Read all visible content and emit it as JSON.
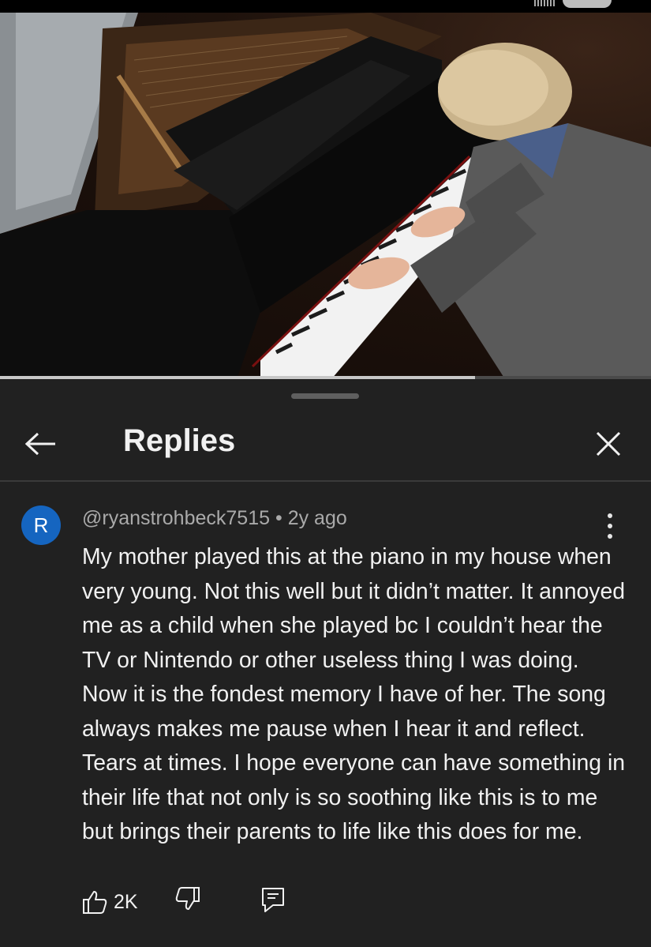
{
  "header": {
    "title": "Replies"
  },
  "video": {
    "progress_fraction": 0.73
  },
  "comment": {
    "avatar_letter": "R",
    "author": "@ryanstrohbeck7515",
    "separator": "•",
    "time": "2y ago",
    "text": "My mother played this at the piano in my house when very young. Not this well but it didn’t matter. It annoyed me as a child when she played bc I couldn’t hear the TV or Nintendo or other useless thing I was doing. Now it is the fondest memory I have of her. The song always makes me pause when I hear it and reflect. Tears at times. I hope everyone can have something in their life that not only is so soothing like this is to me but brings their parents to life like this does for me.",
    "likes": "2K"
  },
  "icons": {
    "back": "arrow-left-icon",
    "close": "close-icon",
    "more": "more-vertical-icon",
    "like": "thumbs-up-icon",
    "dislike": "thumbs-down-icon",
    "reply": "comment-reply-icon"
  },
  "colors": {
    "background": "#212121",
    "avatar": "#1565c0",
    "secondary_text": "#aaaaaa",
    "primary_text": "#f1f1f1"
  }
}
